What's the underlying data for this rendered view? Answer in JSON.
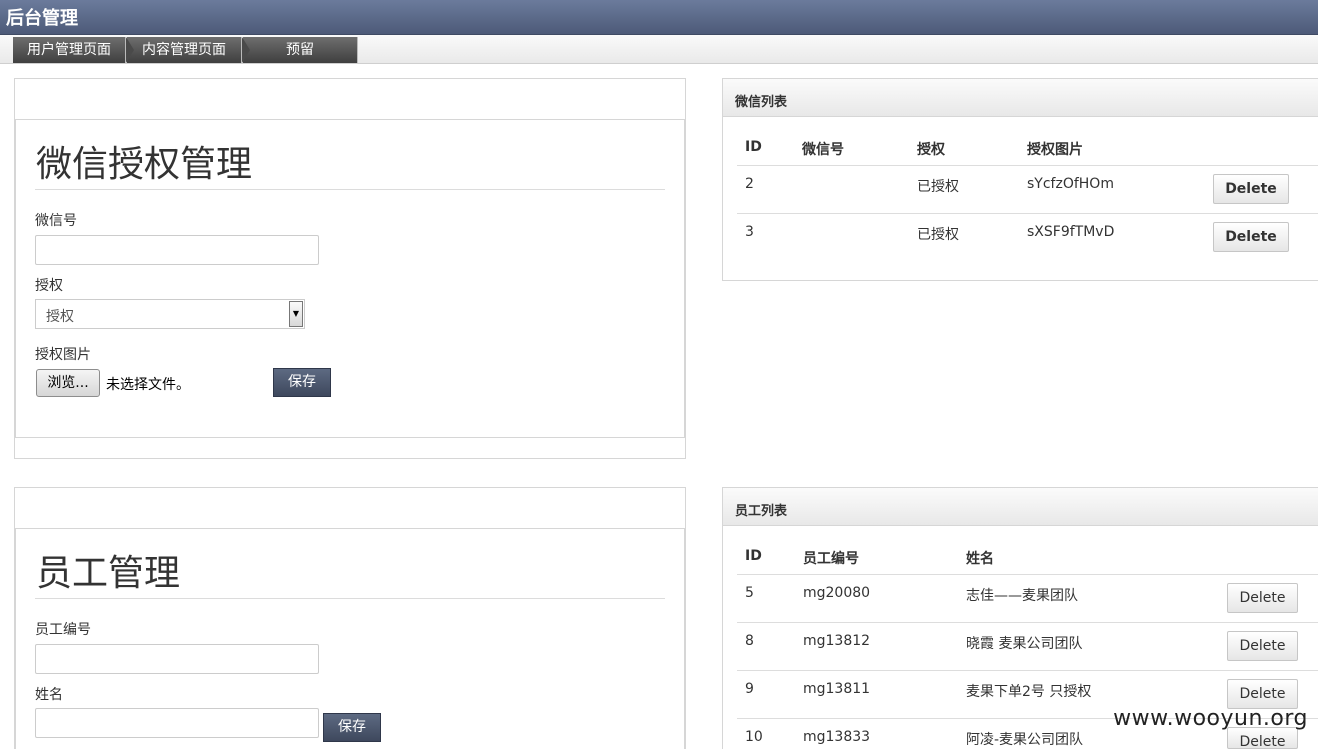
{
  "app": {
    "title": "后台管理"
  },
  "menu": {
    "tabs": [
      {
        "label": "用户管理页面"
      },
      {
        "label": "内容管理页面"
      },
      {
        "label": "预留"
      }
    ]
  },
  "wechat_form": {
    "title": "微信授权管理",
    "wechat_label": "微信号",
    "wechat_value": "",
    "auth_label": "授权",
    "auth_selected": "授权",
    "image_label": "授权图片",
    "browse_label": "浏览...",
    "file_status": "未选择文件。",
    "save_label": "保存"
  },
  "wechat_list": {
    "header": "微信列表",
    "columns": [
      "ID",
      "微信号",
      "授权",
      "授权图片"
    ],
    "rows": [
      {
        "id": "2",
        "wechat": "",
        "auth": "已授权",
        "image": "sYcfzOfHOm",
        "action": "Delete"
      },
      {
        "id": "3",
        "wechat": "",
        "auth": "已授权",
        "image": "sXSF9fTMvD",
        "action": "Delete"
      }
    ]
  },
  "staff_form": {
    "title": "员工管理",
    "number_label": "员工编号",
    "number_value": "",
    "name_label": "姓名",
    "name_value": "",
    "save_label": "保存"
  },
  "staff_list": {
    "header": "员工列表",
    "columns": [
      "ID",
      "员工编号",
      "姓名"
    ],
    "rows": [
      {
        "id": "5",
        "number": "mg20080",
        "name": "志佳——麦果团队",
        "action": "Delete"
      },
      {
        "id": "8",
        "number": "mg13812",
        "name": "晓霞 麦果公司团队",
        "action": "Delete"
      },
      {
        "id": "9",
        "number": "mg13811",
        "name": "麦果下单2号 只授权",
        "action": "Delete"
      },
      {
        "id": "10",
        "number": "mg13833",
        "name": "阿凌-麦果公司团队",
        "action": "Delete"
      }
    ]
  },
  "watermark": "www.wooyun.org",
  "colors": {
    "titlebar": "#5a6888",
    "menu_tab": "#555555",
    "save_button": "#4b556c"
  }
}
